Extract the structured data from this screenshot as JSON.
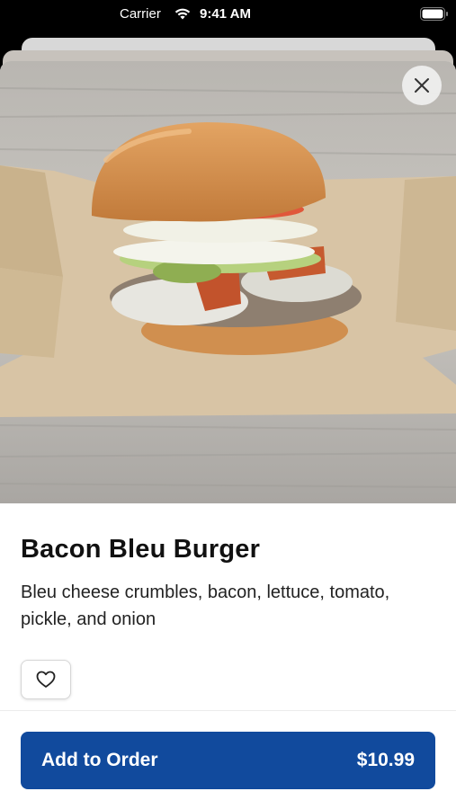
{
  "status_bar": {
    "carrier": "Carrier",
    "time": "9:41 AM",
    "wifi_icon": "wifi-icon",
    "battery_icon": "battery-icon"
  },
  "item": {
    "image_icon": "burger-photo",
    "name": "Bacon Bleu Burger",
    "description": "Bleu cheese crumbles, bacon, lettuce, tomato, pickle, and onion"
  },
  "actions": {
    "close_icon": "close-icon",
    "favorite_icon": "heart-icon",
    "add_to_order_label": "Add to Order",
    "price": "$10.99"
  },
  "colors": {
    "accent": "#114a9d",
    "background": "#ffffff",
    "text": "#111111"
  }
}
